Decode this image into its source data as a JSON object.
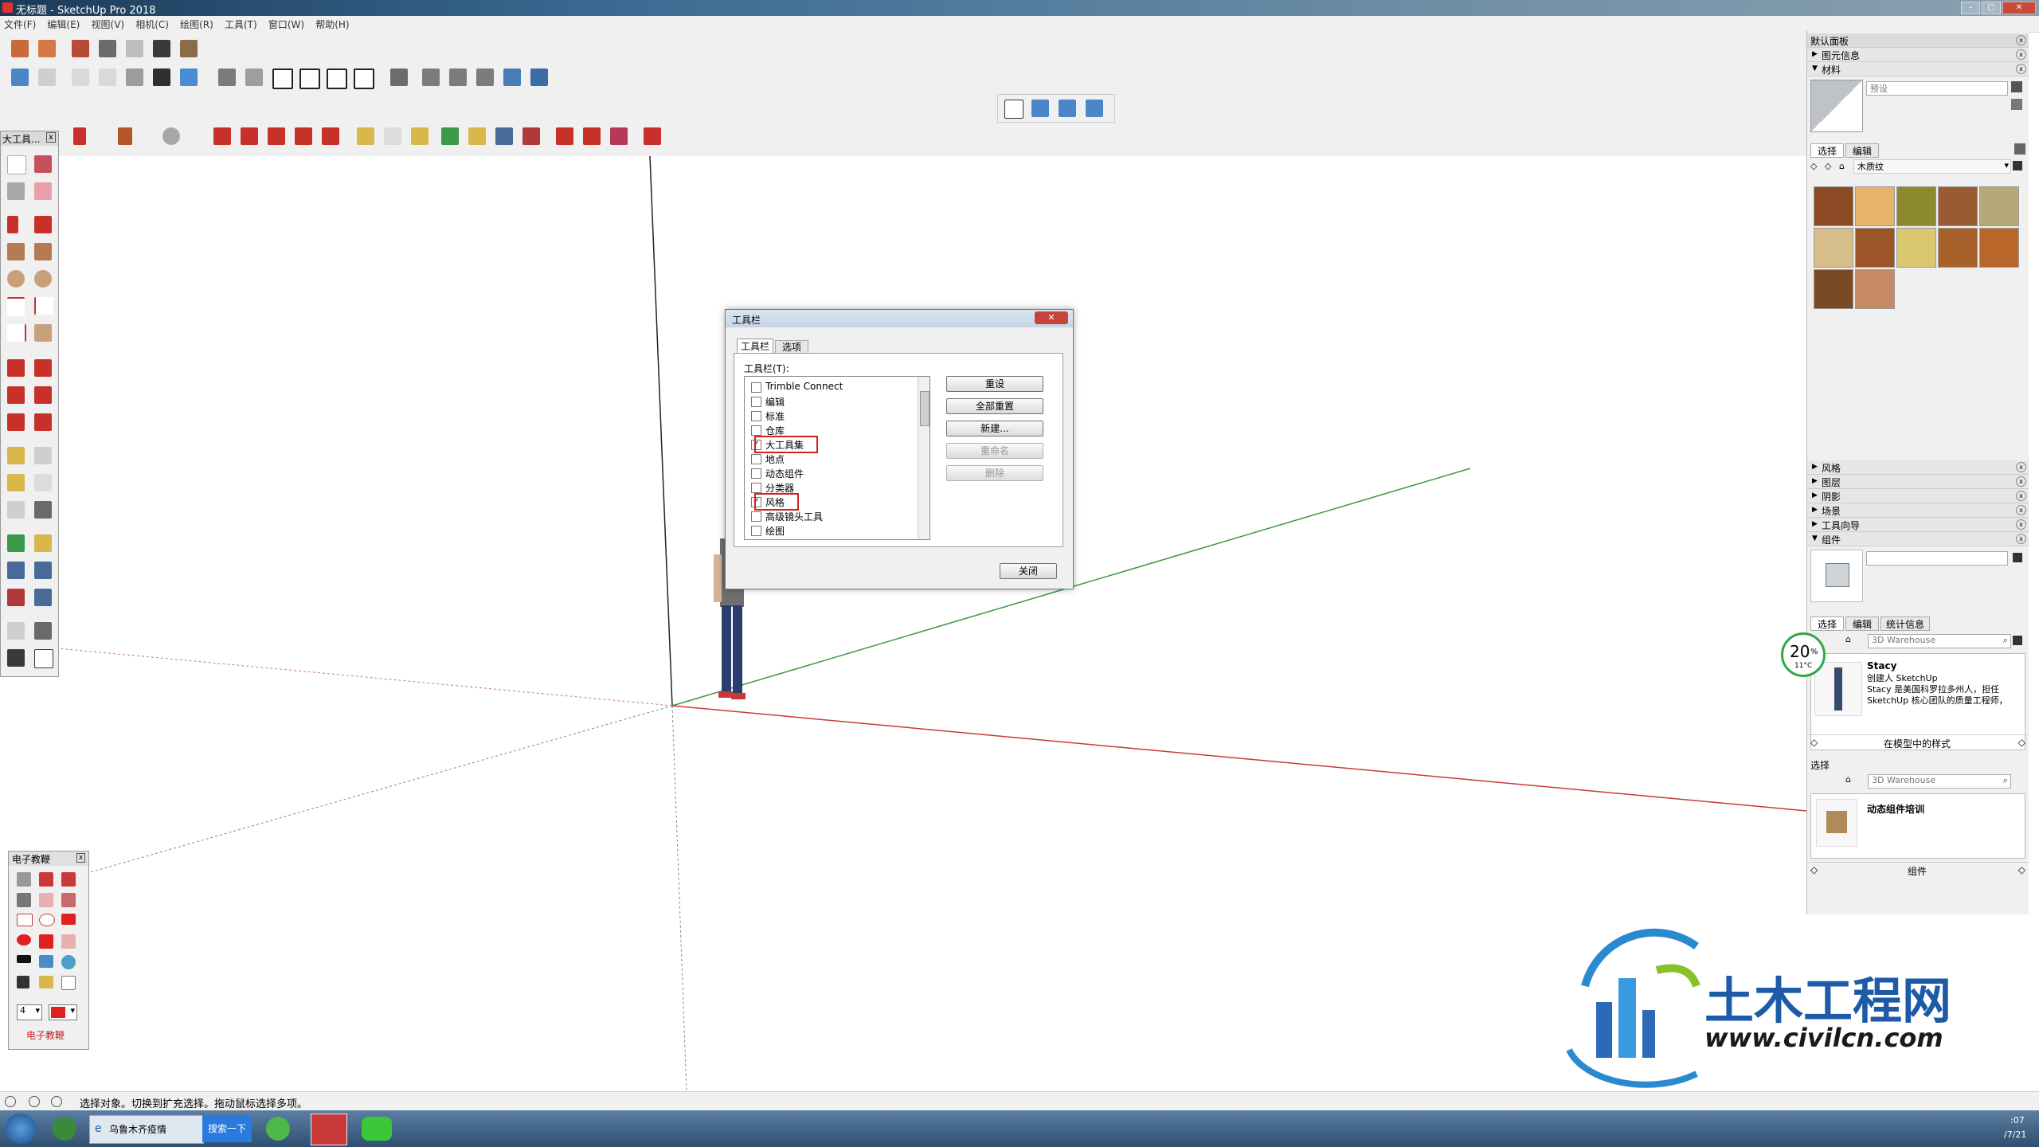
{
  "window": {
    "title": "无标题 - SketchUp Pro 2018"
  },
  "menu": [
    "文件(F)",
    "编辑(E)",
    "视图(V)",
    "相机(C)",
    "绘图(R)",
    "工具(T)",
    "窗口(W)",
    "帮助(H)"
  ],
  "left_toolbar": {
    "title": "大工具..."
  },
  "dialog": {
    "title": "工具栏",
    "tabs": [
      "工具栏",
      "选项"
    ],
    "list_label": "工具栏(T):",
    "items": [
      {
        "label": "Trimble Connect",
        "checked": false,
        "highlight": false
      },
      {
        "label": "编辑",
        "checked": false,
        "highlight": false
      },
      {
        "label": "标准",
        "checked": false,
        "highlight": false
      },
      {
        "label": "仓库",
        "checked": false,
        "highlight": false
      },
      {
        "label": "大工具集",
        "checked": true,
        "highlight": true
      },
      {
        "label": "地点",
        "checked": false,
        "highlight": false
      },
      {
        "label": "动态组件",
        "checked": false,
        "highlight": false
      },
      {
        "label": "分类器",
        "checked": false,
        "highlight": false
      },
      {
        "label": "风格",
        "checked": true,
        "highlight": true
      },
      {
        "label": "高级镜头工具",
        "checked": false,
        "highlight": false
      },
      {
        "label": "绘图",
        "checked": false,
        "highlight": false
      }
    ],
    "buttons": {
      "reset": "重设",
      "reset_all": "全部重置",
      "new": "新建...",
      "rename": "重命名",
      "delete": "删除",
      "close": "关闭"
    }
  },
  "right_panel": {
    "title": "默认面板",
    "entity_info": "图元信息",
    "materials": "材料",
    "material_name_placeholder": "预设",
    "mat_tabs": [
      "选择",
      "编辑"
    ],
    "mat_library": "木质纹",
    "swatch_colors": [
      "#8b4a24",
      "#e6b46a",
      "#8c8a2a",
      "#9a5a32",
      "#b7a878",
      "#d7bd8a",
      "#9b5526",
      "#d9c870",
      "#a8612a",
      "#b8662a",
      "#7a4a24",
      "#c58a64"
    ],
    "collapsed": [
      "风格",
      "图层",
      "阴影",
      "场景",
      "工具向导"
    ],
    "components": "组件",
    "comp_tabs": [
      "选择",
      "编辑",
      "统计信息"
    ],
    "search_placeholder": "3D Warehouse",
    "component": {
      "name": "Stacy",
      "line1": "创建人 SketchUp",
      "line2": "Stacy 是美国科罗拉多州人，担任",
      "line3": "SketchUp 核心团队的质量工程师，"
    },
    "in_model": "在模型中的样式",
    "second_select": "选择",
    "second_item": "动态组件培训",
    "bottom": "组件"
  },
  "mini_toolbar": {
    "title": "电子教鞭",
    "size": "4",
    "footer": "电子教鞭"
  },
  "status": {
    "text": "选择对象。切换到扩充选择。拖动鼠标选择多项。"
  },
  "weather": {
    "percent": "20",
    "unit": "%",
    "temp": "11°C"
  },
  "watermark": {
    "cn": "土木工程网",
    "url": "www.civilcn.com"
  },
  "taskbar": {
    "browser": "乌鲁木齐疫情",
    "search": "搜索一下",
    "time": ":07",
    "date": "/7/21"
  }
}
